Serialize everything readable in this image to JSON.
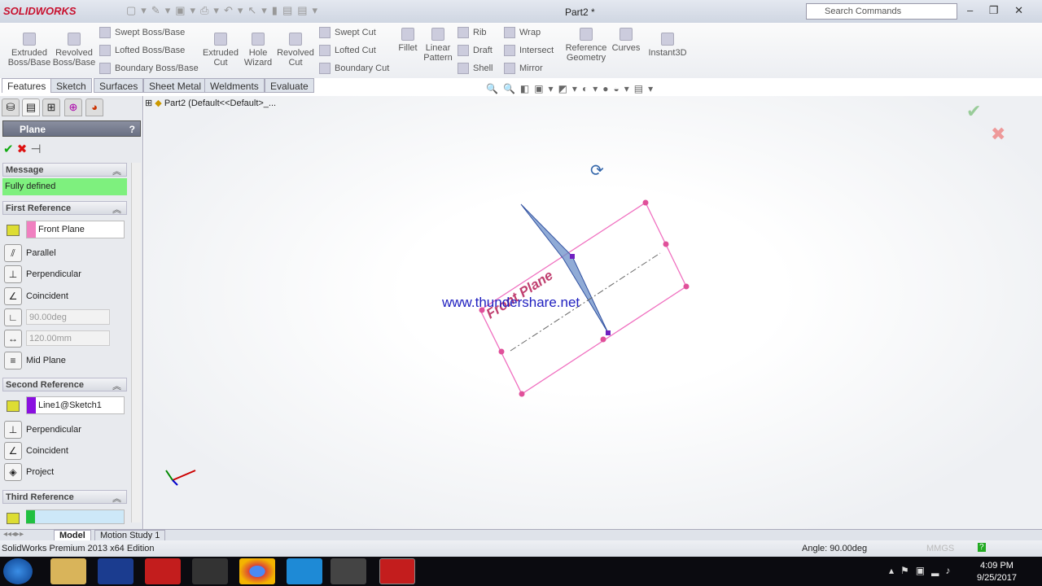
{
  "app": {
    "logo": "SOLIDWORKS",
    "title": "Part2 *",
    "search_placeholder": "Search Commands",
    "window_controls": "– ❐ ✕"
  },
  "ribbon": {
    "extruded_boss": "Extruded Boss/Base",
    "revolved_boss": "Revolved Boss/Base",
    "swept_boss": "Swept Boss/Base",
    "lofted_boss": "Lofted Boss/Base",
    "boundary_boss": "Boundary Boss/Base",
    "extruded_cut": "Extruded Cut",
    "hole_wizard": "Hole Wizard",
    "revolved_cut": "Revolved Cut",
    "swept_cut": "Swept Cut",
    "lofted_cut": "Lofted Cut",
    "boundary_cut": "Boundary Cut",
    "fillet": "Fillet",
    "linear_pattern": "Linear Pattern",
    "rib": "Rib",
    "draft": "Draft",
    "shell": "Shell",
    "wrap": "Wrap",
    "intersect": "Intersect",
    "mirror": "Mirror",
    "reference_geometry": "Reference Geometry",
    "curves": "Curves",
    "instant3d": "Instant3D"
  },
  "tabs": [
    "Features",
    "Sketch",
    "Surfaces",
    "Sheet Metal",
    "Weldments",
    "Evaluate"
  ],
  "panel": {
    "title": "Plane",
    "help": "?",
    "message_header": "Message",
    "message": "Fully defined",
    "first_ref": {
      "header": "First Reference",
      "value": "Front Plane",
      "color": "#f080c0",
      "options": [
        "Parallel",
        "Perpendicular",
        "Coincident"
      ],
      "angle": "90.00deg",
      "distance": "120.00mm",
      "mid_plane": "Mid Plane"
    },
    "second_ref": {
      "header": "Second Reference",
      "value": "Line1@Sketch1",
      "color": "#8a10e0",
      "options": [
        "Perpendicular",
        "Coincident",
        "Project"
      ]
    },
    "third_ref": {
      "header": "Third Reference",
      "value": "",
      "color": "#20c040"
    }
  },
  "tree": {
    "root": "Part2  (Default<<Default>_..."
  },
  "viewport": {
    "plane_label": "Front Plane",
    "watermark": "www.thundershare.net"
  },
  "bottom_tabs": [
    "Model",
    "Motion Study 1"
  ],
  "status": {
    "edition": "SolidWorks Premium 2013 x64 Edition",
    "angle": "Angle: 90.00deg",
    "units": "MMGS"
  },
  "clock": {
    "time": "4:09 PM",
    "date": "9/25/2017"
  }
}
